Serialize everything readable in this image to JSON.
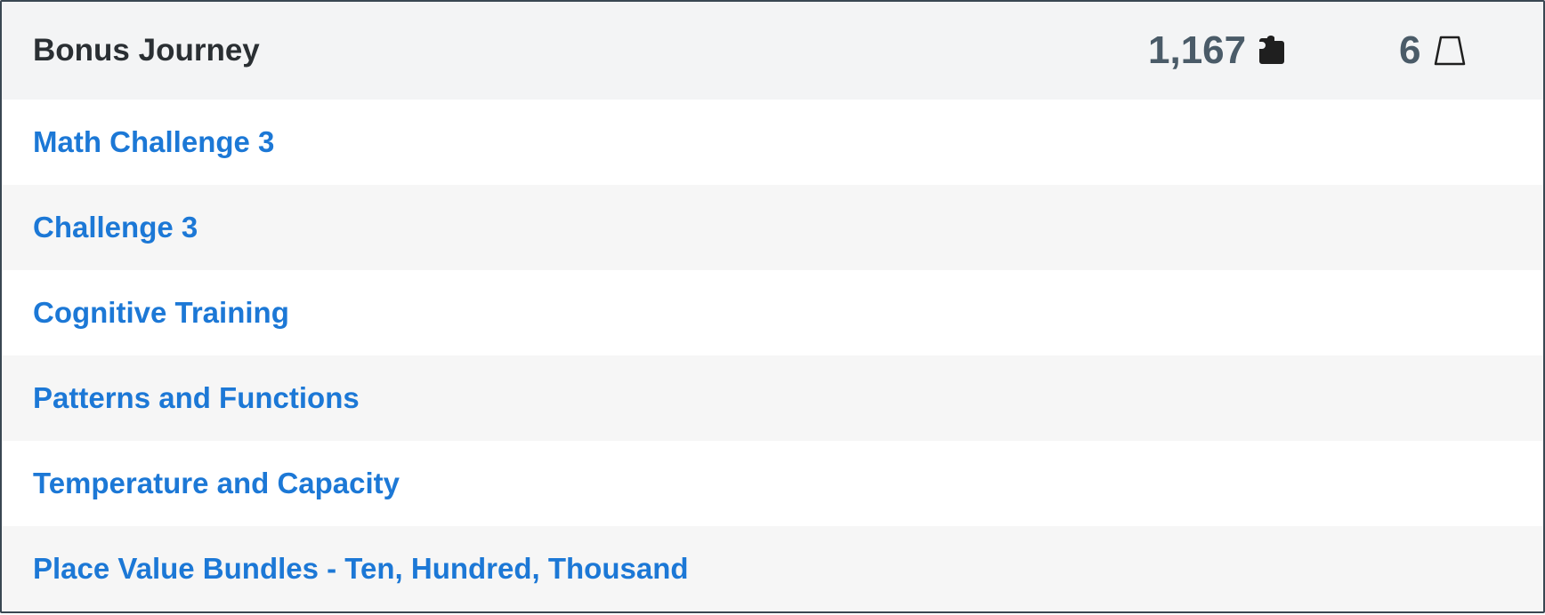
{
  "header": {
    "title": "Bonus Journey",
    "pieces_count": "1,167",
    "pieces_icon": "puzzle-piece-icon",
    "levels_count": "6",
    "levels_icon": "trapezoid-icon"
  },
  "items": [
    {
      "label": "Math Challenge 3"
    },
    {
      "label": "Challenge 3"
    },
    {
      "label": "Cognitive Training"
    },
    {
      "label": "Patterns and Functions"
    },
    {
      "label": "Temperature and Capacity"
    },
    {
      "label": "Place Value Bundles - Ten, Hundred, Thousand"
    }
  ],
  "colors": {
    "link": "#1c78d6",
    "header_bg": "#f3f4f5",
    "stat_text": "#4a5b68",
    "border": "#3a4752"
  }
}
